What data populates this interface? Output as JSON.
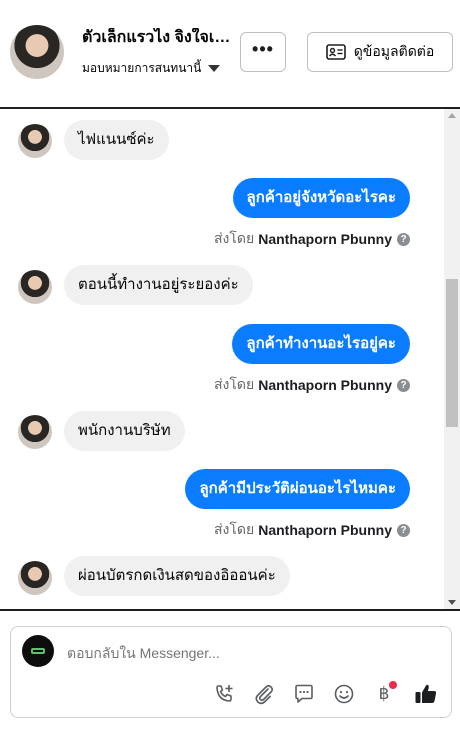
{
  "header": {
    "contact_name": "ตัวเล็กแรวไง จิงใจเสมอ",
    "assign_label": "มอบหมายการสนทนานี้",
    "more_label": "•••",
    "contact_info_label": "ดูข้อมูลติดต่อ"
  },
  "messages": [
    {
      "direction": "in",
      "text": "ไฟแนนซ์ค่ะ"
    },
    {
      "direction": "out",
      "text": "ลูกค้าอยู่จังหวัดอะไรคะ",
      "sent_by_prefix": "ส่งโดย",
      "sent_by_name": "Nanthaporn Pbunny"
    },
    {
      "direction": "in",
      "text": "ตอนนี้ทำงานอยู่ระยองค่ะ"
    },
    {
      "direction": "out",
      "text": "ลูกค้าทำงานอะไรอยู่คะ",
      "sent_by_prefix": "ส่งโดย",
      "sent_by_name": "Nanthaporn Pbunny"
    },
    {
      "direction": "in",
      "text": "พนักงานบริษัท"
    },
    {
      "direction": "out",
      "text": "ลูกค้ามีประวัติผ่อนอะไรไหมคะ",
      "sent_by_prefix": "ส่งโดย",
      "sent_by_name": "Nanthaporn Pbunny"
    },
    {
      "direction": "in",
      "text": "ผ่อนบัตรกดเงินสดของอิออนค่ะ"
    }
  ],
  "help_icon_label": "?",
  "composer": {
    "placeholder": "ตอบกลับใน Messenger...",
    "tools": [
      "phone-plus-icon",
      "paperclip-icon",
      "saved-replies-icon",
      "emoji-icon",
      "baht-icon",
      "like-icon"
    ],
    "baht_symbol": "฿"
  },
  "colors": {
    "outgoing_bubble": "#0a7cff",
    "incoming_bubble": "#f0f0f0",
    "notification_dot": "#f02849"
  }
}
